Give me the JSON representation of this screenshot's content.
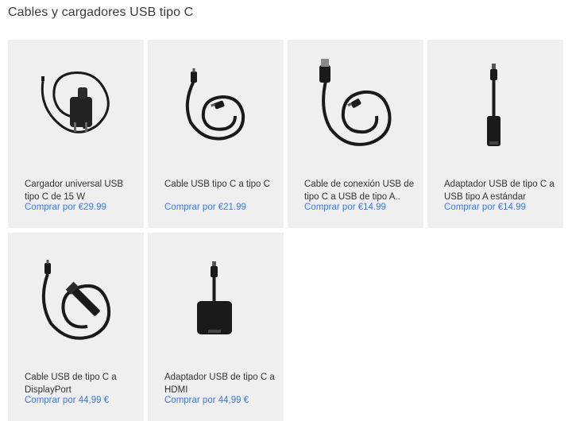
{
  "page": {
    "title": "Cables y cargadores USB tipo C"
  },
  "products": [
    {
      "name": "Cargador universal USB tipo C de 15 W",
      "buy": "Comprar por €29.99",
      "icon": "charger-with-cable-icon"
    },
    {
      "name": "Cable USB tipo C a tipo C",
      "buy": "Comprar por €21.99",
      "icon": "usbc-to-usbc-cable-icon"
    },
    {
      "name": "Cable de conexión USB de tipo C a USB de tipo A..",
      "buy": "Comprar por €14.99",
      "icon": "usbc-to-usba-cable-icon"
    },
    {
      "name": "Adaptador USB de tipo C a USB tipo A estándar",
      "buy": "Comprar por €14.99",
      "icon": "usbc-to-usba-adapter-icon"
    },
    {
      "name": "Cable USB de tipo C a DisplayPort",
      "buy": "Comprar por 44,99 €",
      "icon": "usbc-to-displayport-cable-icon"
    },
    {
      "name": "Adaptador USB de tipo C a HDMI",
      "buy": "Comprar por 44,99 €",
      "icon": "usbc-to-hdmi-adapter-icon"
    }
  ]
}
